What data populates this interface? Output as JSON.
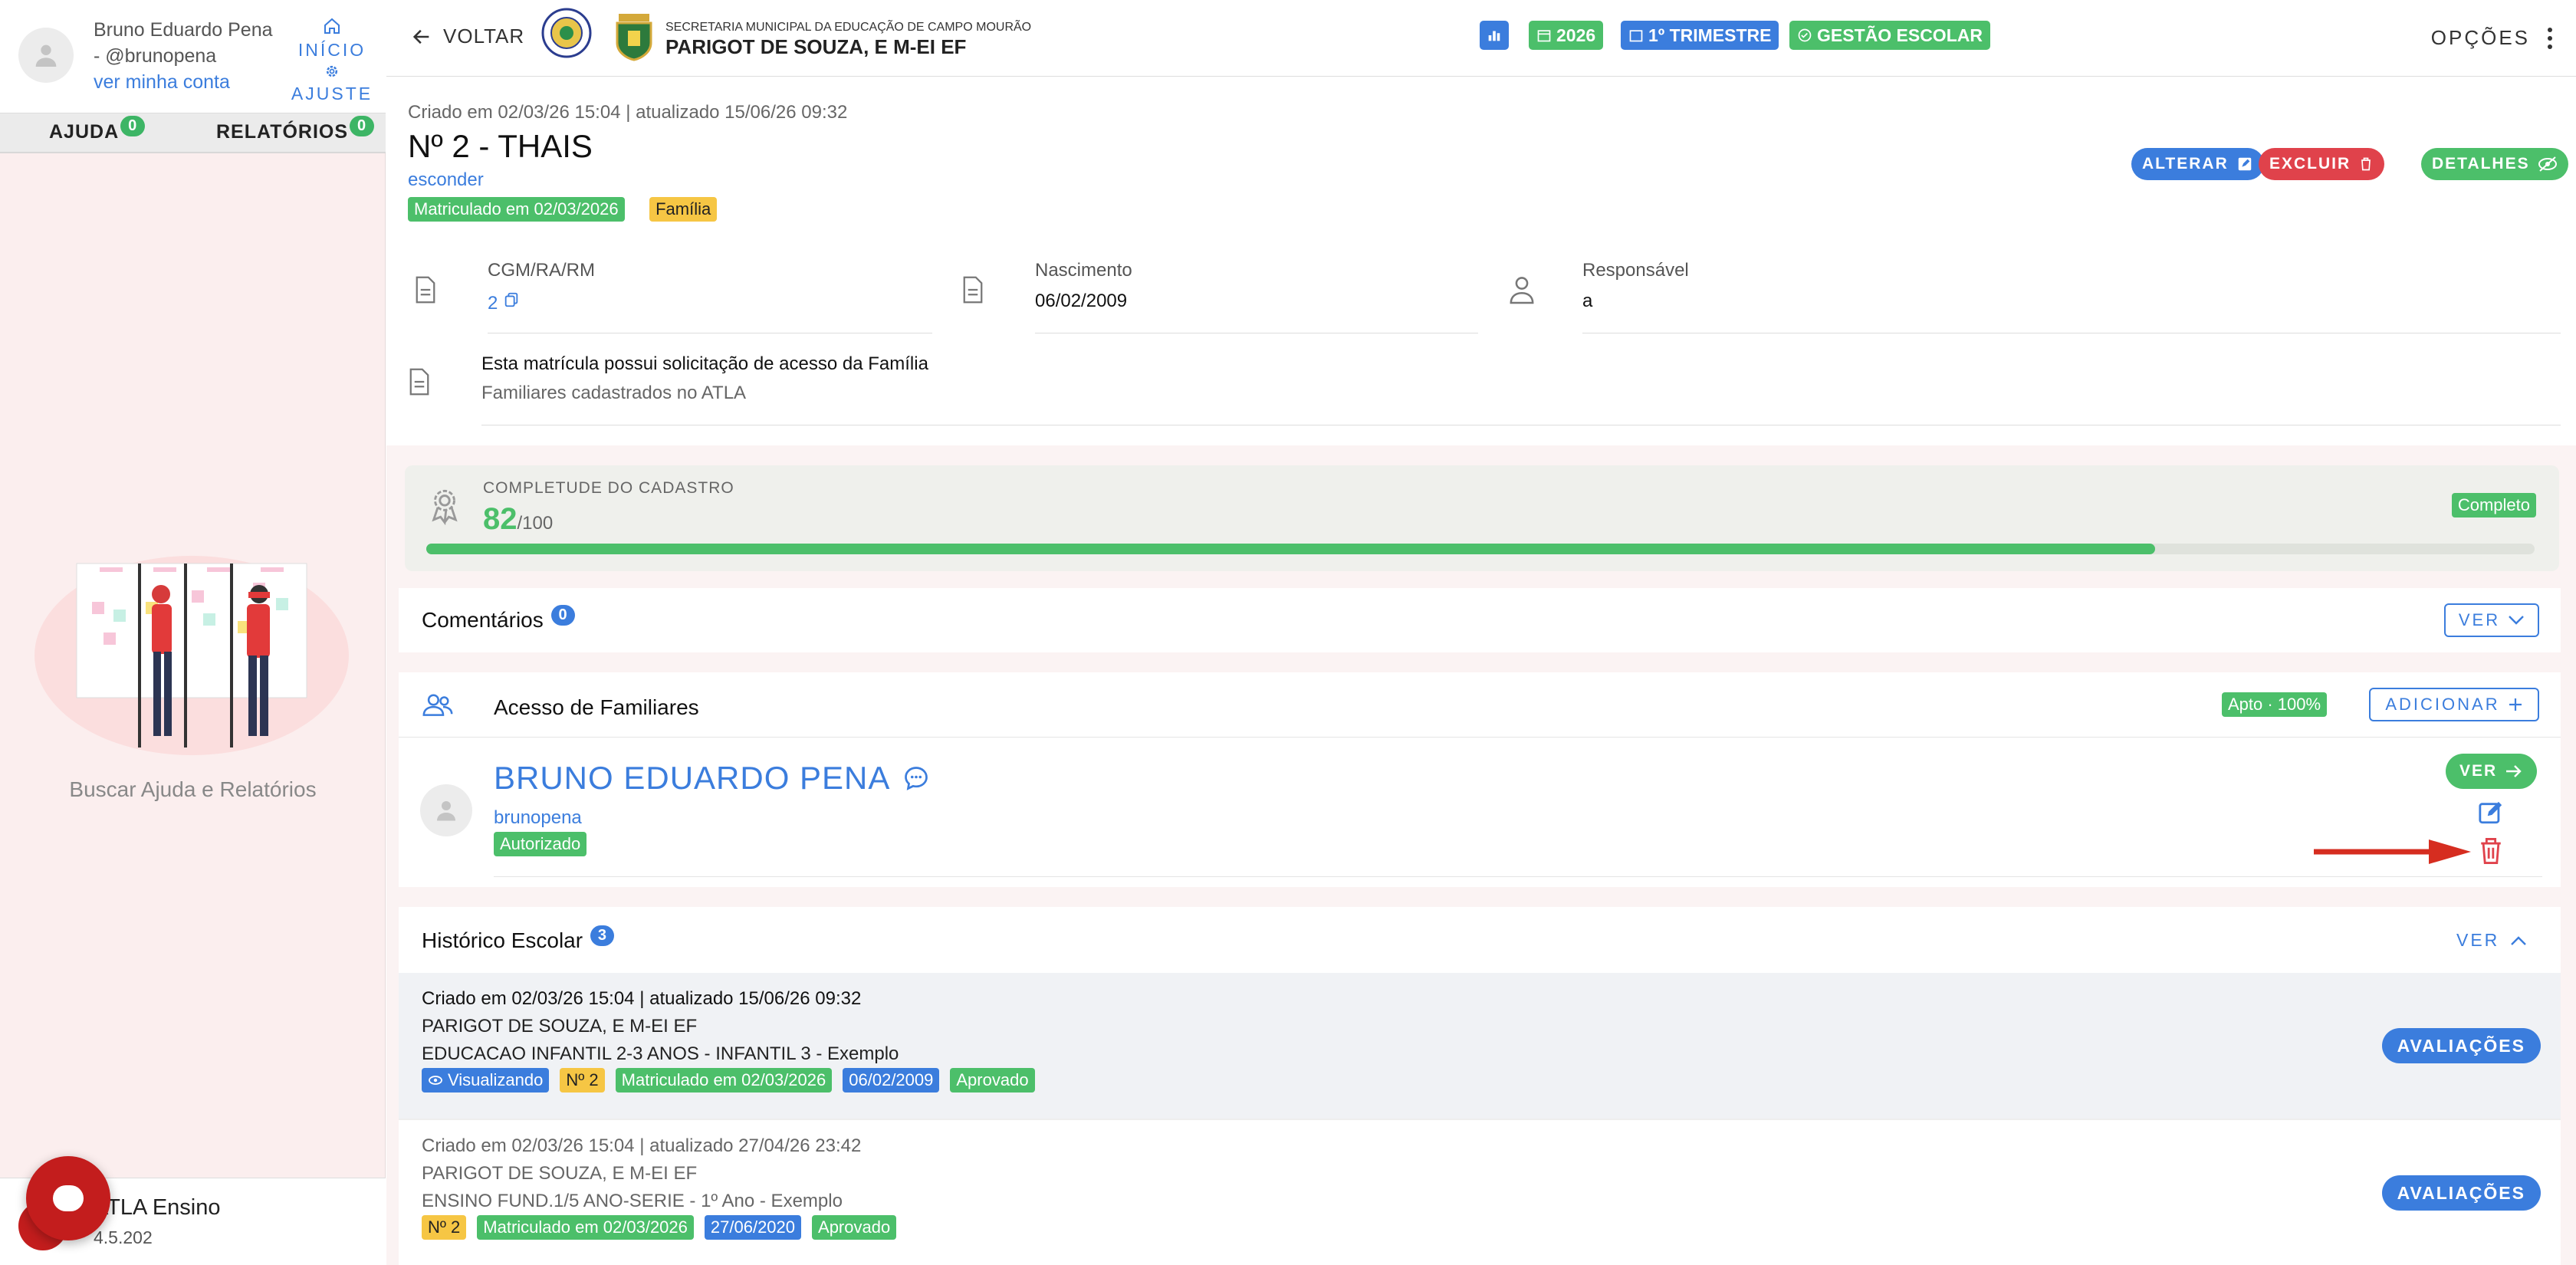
{
  "sidebar": {
    "user_name": "Bruno Eduardo Pena",
    "user_handle": "- @brunopena",
    "view_account": "ver minha conta",
    "home_label": "INÍCIO",
    "settings_label": "AJUSTE",
    "tabs": [
      {
        "label": "AJUDA",
        "count": "0"
      },
      {
        "label": "RELATÓRIOS",
        "count": "0"
      }
    ],
    "caption": "Buscar Ajuda e Relatórios",
    "app_name": "ATLA Ensino",
    "app_version": "4.5.202"
  },
  "topbar": {
    "back_label": "VOLTAR",
    "school_small": "SECRETARIA MUNICIPAL DA EDUCAÇÃO DE CAMPO MOURÃO",
    "school_name": "PARIGOT DE SOUZA, E M-EI EF",
    "year": "2026",
    "period": "1º TRIMESTRE",
    "module": "GESTÃO ESCOLAR",
    "options_label": "OPÇÕES"
  },
  "record": {
    "meta": "Criado em 02/03/26 15:04 | atualizado 15/06/26 09:32",
    "title": "Nº 2 - THAIS",
    "hide_link": "esconder",
    "badge_enrolled": "Matriculado em 02/03/2026",
    "badge_family": "Família",
    "edit_label": "ALTERAR",
    "delete_label": "EXCLUIR",
    "details_label": "DETALHES",
    "cgm_label": "CGM/RA/RM",
    "cgm_value": "2",
    "birth_label": "Nascimento",
    "birth_value": "06/02/2009",
    "resp_label": "Responsável",
    "resp_value": "a",
    "access_line1": "Esta matrícula possui solicitação de acesso da Família",
    "access_line2": "Familiares cadastrados no ATLA"
  },
  "completeness": {
    "label": "COMPLETUDE DO CADASTRO",
    "score": "82",
    "max": "/100",
    "status": "Completo",
    "progress_fraction": 0.82
  },
  "comments": {
    "title": "Comentários",
    "count": "0",
    "view_label": "VER"
  },
  "family_access": {
    "title": "Acesso de Familiares",
    "status": "Apto · 100%",
    "add_label": "ADICIONAR",
    "member_name": "BRUNO EDUARDO PENA",
    "member_user": "brunopena",
    "member_status": "Autorizado",
    "view_label": "VER"
  },
  "history": {
    "title": "Histórico Escolar",
    "count": "3",
    "view_label": "VER",
    "items": [
      {
        "meta": "Criado em 02/03/26 15:04 | atualizado 15/06/26 09:32",
        "school": "PARIGOT DE SOUZA, E M-EI EF",
        "class": "EDUCACAO INFANTIL 2-3 ANOS - INFANTIL 3 - Exemplo",
        "badges": [
          "Visualizando",
          "Nº 2",
          "Matriculado em 02/03/2026",
          "06/02/2009",
          "Aprovado"
        ],
        "button": "AVALIAÇÕES"
      },
      {
        "meta": "Criado em 02/03/26 15:04 | atualizado 27/04/26 23:42",
        "school": "PARIGOT DE SOUZA, E M-EI EF",
        "class": "ENSINO FUND.1/5 ANO-SERIE - 1º Ano - Exemplo",
        "badges": [
          "Nº 2",
          "Matriculado em 02/03/2026",
          "27/06/2020",
          "Aprovado"
        ],
        "button": "AVALIAÇÕES"
      }
    ]
  },
  "colors": {
    "primary": "#3b7ddd",
    "success": "#4cbf6a",
    "danger": "#e0424b",
    "warning": "#f6c644",
    "annotation_arrow": "#d62d20"
  },
  "icons": [
    "back-arrow-icon",
    "home-icon",
    "gear-icon",
    "chart-icon",
    "calendar-icon",
    "trimester-icon",
    "check-icon",
    "dots-vertical-icon",
    "edit-icon",
    "trash-icon",
    "eye-off-icon",
    "document-icon",
    "person-icon",
    "copy-icon",
    "award-icon",
    "chevron-down-icon",
    "people-icon",
    "plus-icon",
    "chat-icon",
    "arrow-right-icon",
    "eye-icon",
    "chevron-up-icon"
  ]
}
